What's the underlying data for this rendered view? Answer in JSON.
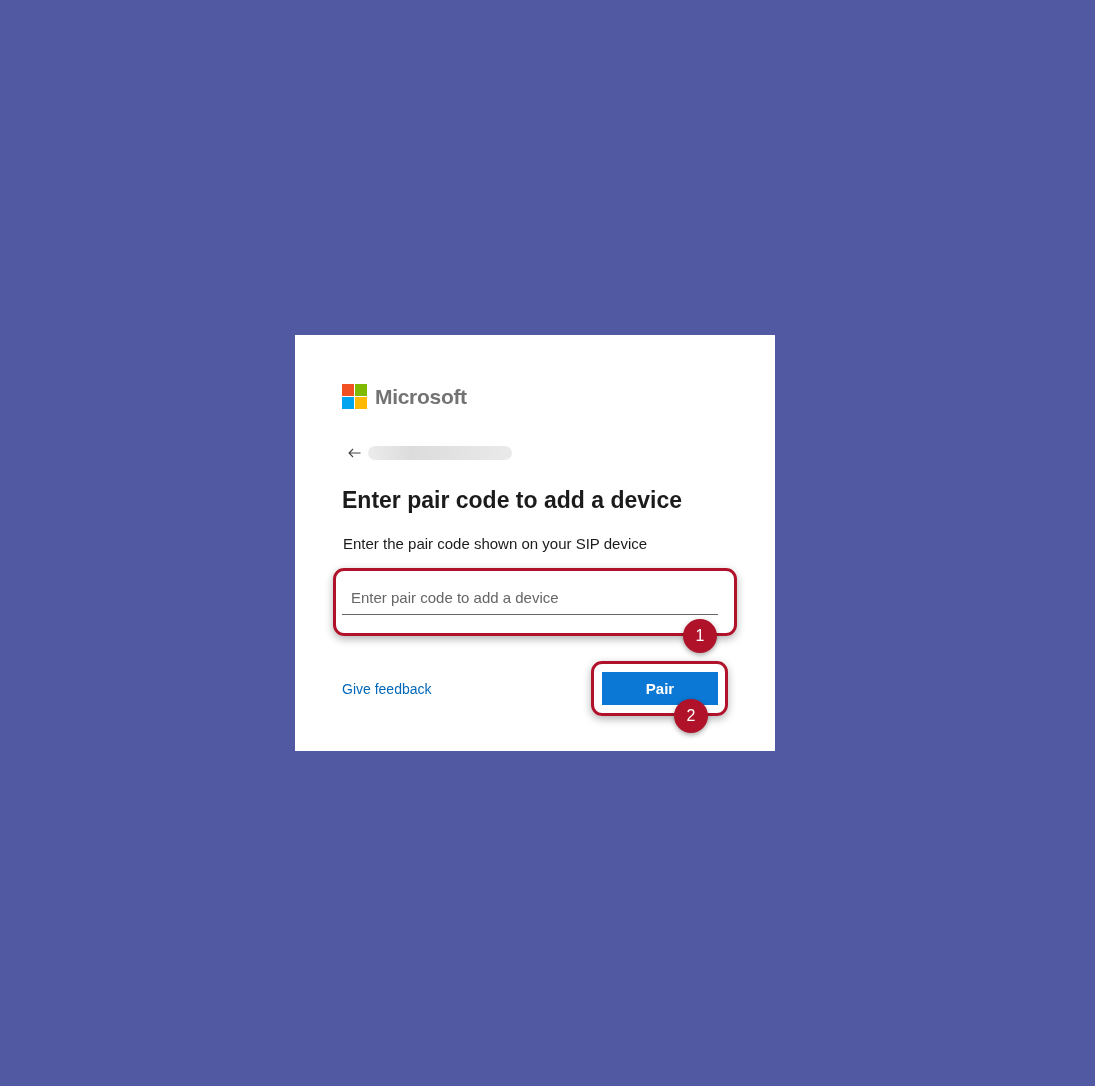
{
  "brand": {
    "name": "Microsoft"
  },
  "heading": "Enter pair code to add a device",
  "description": "Enter the pair code shown on your SIP device",
  "pair_code_field": {
    "placeholder": "Enter pair code to add a device",
    "callout": "1"
  },
  "feedback_link": "Give feedback",
  "pair_button": {
    "label": "Pair",
    "callout": "2"
  }
}
